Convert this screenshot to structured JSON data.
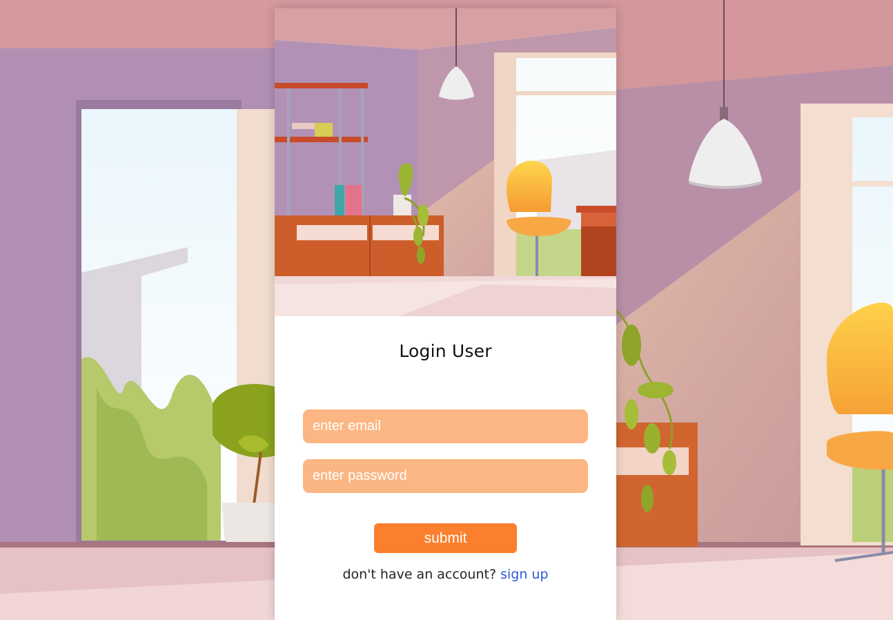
{
  "login": {
    "title": "Login User",
    "email_placeholder": "enter email",
    "password_placeholder": "enter password",
    "submit_label": "submit",
    "signup_prompt": "don't have an account?",
    "signup_link": "sign up"
  },
  "colors": {
    "input_bg": "#fcb683",
    "button_bg": "#fb7f2c",
    "link": "#2b58d6"
  }
}
